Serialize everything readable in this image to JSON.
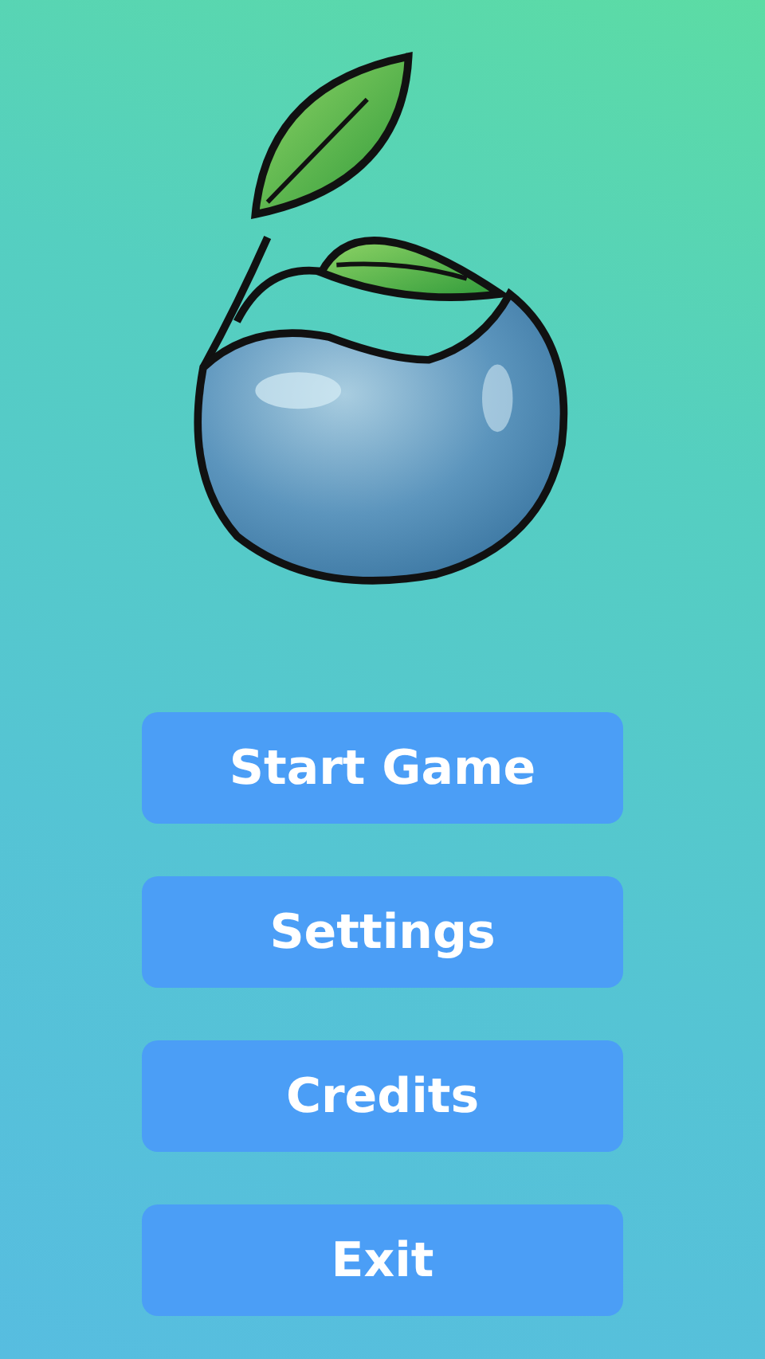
{
  "menu": {
    "buttons": [
      {
        "label": "Start Game"
      },
      {
        "label": "Settings"
      },
      {
        "label": "Credits"
      },
      {
        "label": "Exit"
      }
    ]
  }
}
